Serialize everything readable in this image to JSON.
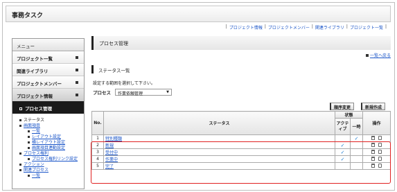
{
  "app": {
    "title": "事務タスク"
  },
  "topnav": [
    "プロジェクト情報",
    "プロジェクトメンバー",
    "関連ライブラリ",
    "プロジェクト一覧"
  ],
  "sidebar": {
    "menu_label": "メニュー",
    "items": [
      "プロジェクト一覧",
      "関連ライブラリ",
      "プロジェクトメンバー",
      "プロジェクト情報"
    ],
    "sub_active": "プロセス管理",
    "tree": [
      {
        "label": "ステータス",
        "level": 1,
        "link": false
      },
      {
        "label": "画面項目",
        "level": 1,
        "link": true
      },
      {
        "label": "一覧",
        "level": 2
      },
      {
        "label": "レイアウト設定",
        "level": 2
      },
      {
        "label": "横レイアウト設定",
        "level": 2
      },
      {
        "label": "画面項目連動設定",
        "level": 2
      },
      {
        "label": "プロセス権利",
        "level": 1,
        "link": true
      },
      {
        "label": "プロセス権利リンク設定",
        "level": 2
      },
      {
        "label": "アクション",
        "level": 1,
        "link": true
      },
      {
        "label": "関連プロセス",
        "level": 1,
        "link": true
      },
      {
        "label": "一覧",
        "level": 2
      }
    ]
  },
  "main": {
    "page_title": "プロセス管理",
    "back_link": "一覧へ戻る",
    "section_title": "ステータス一覧",
    "instruction": "設定する範囲を選択して下さい。",
    "process_label": "プロセス",
    "process_value": "作業依頼管理",
    "reorder_button": "順序変更",
    "new_button": "新規作成",
    "table": {
      "col_no": "No.",
      "col_status": "ステータス",
      "col_state": "状態",
      "col_active": "アクティブ",
      "col_temp": "一時",
      "col_ops": "操作",
      "rows": [
        {
          "no": "1",
          "name": "特別種類",
          "active": false,
          "temp": true
        },
        {
          "no": "2",
          "name": "新規",
          "active": true,
          "temp": false
        },
        {
          "no": "3",
          "name": "受付中",
          "active": true,
          "temp": false
        },
        {
          "no": "4",
          "name": "作業中",
          "active": true,
          "temp": false
        },
        {
          "no": "5",
          "name": "完了",
          "active": false,
          "temp": false
        }
      ]
    }
  },
  "colors": {
    "link": "#1a55c8",
    "check": "#1a7bd0",
    "highlight": "#e02020"
  }
}
